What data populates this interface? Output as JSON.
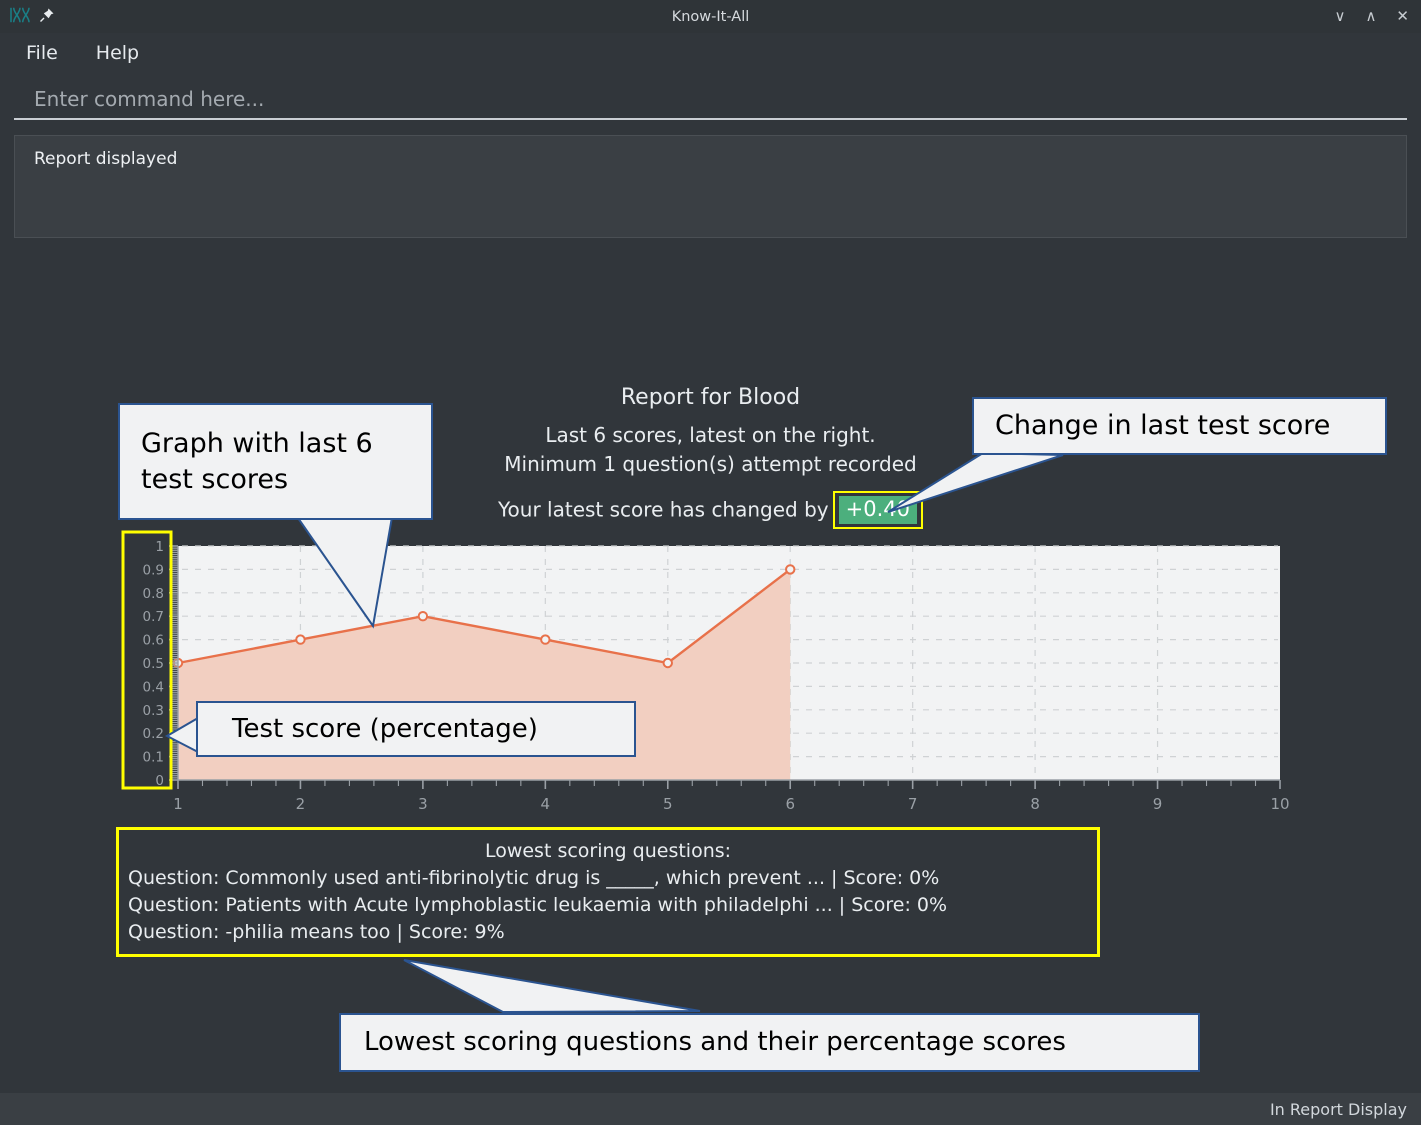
{
  "window": {
    "title": "Know-It-All",
    "logo_icon": "dna-logo-icon",
    "pin_icon": "pin-icon",
    "minimize_glyph": "∨",
    "maximize_glyph": "∧",
    "close_glyph": "✕"
  },
  "menubar": {
    "items": [
      {
        "label": "File"
      },
      {
        "label": "Help"
      }
    ]
  },
  "command": {
    "value": "",
    "placeholder": "Enter command here..."
  },
  "log": {
    "text": "Report displayed"
  },
  "report": {
    "title": "Report for Blood",
    "subtitle_line1": "Last 6 scores, latest on the right.",
    "subtitle_line2": "Minimum 1 question(s) attempt recorded",
    "change_prefix": "Your latest score has changed by",
    "change_value": "+0.40",
    "change_badge_color": "#4CAF7D",
    "change_highlight_border": "#ffff00"
  },
  "lowest": {
    "heading": "Lowest scoring questions:",
    "questions": [
      "Question: Commonly used anti-fibrinolytic drug is _____, which prevent ... | Score: 0%",
      "Question: Patients with Acute lymphoblastic leukaemia with philadelphi ... | Score: 0%",
      "Question: -philia means too | Score: 9%"
    ],
    "border_color": "#ffff00"
  },
  "callouts": {
    "graph": "Graph with last 6 test scores",
    "change": "Change in last test score",
    "score": "Test score (percentage)",
    "lowest": "Lowest scoring questions and their percentage scores"
  },
  "statusbar": {
    "text": "In Report Display"
  },
  "chart_data": {
    "type": "line",
    "title": "",
    "xlabel": "",
    "ylabel": "",
    "x": [
      1,
      2,
      3,
      4,
      5,
      6
    ],
    "values": [
      0.5,
      0.6,
      0.7,
      0.6,
      0.5,
      0.9
    ],
    "series": [
      {
        "name": "Test score",
        "values": [
          0.5,
          0.6,
          0.7,
          0.6,
          0.5,
          0.9
        ]
      }
    ],
    "xlim": [
      1,
      10
    ],
    "ylim": [
      0,
      1
    ],
    "xticks": [
      1,
      2,
      3,
      4,
      5,
      6,
      7,
      8,
      9,
      10
    ],
    "xticklabels": [
      "1",
      "2",
      "3",
      "4",
      "5",
      "6",
      "7",
      "8",
      "9",
      "10"
    ],
    "yticks": [
      0,
      0.1,
      0.2,
      0.3,
      0.4,
      0.5,
      0.6,
      0.7,
      0.8,
      0.9,
      1
    ],
    "yticklabels": [
      "0",
      "0.1",
      "0.2",
      "0.3",
      "0.4",
      "0.5",
      "0.6",
      "0.7",
      "0.8",
      "0.9",
      "1"
    ],
    "grid": true,
    "legend": "none",
    "line_color": "#e8714a",
    "fill_color": "#f2cfc1",
    "marker": "circle-open",
    "plot_bg": "#f2f3f4"
  }
}
